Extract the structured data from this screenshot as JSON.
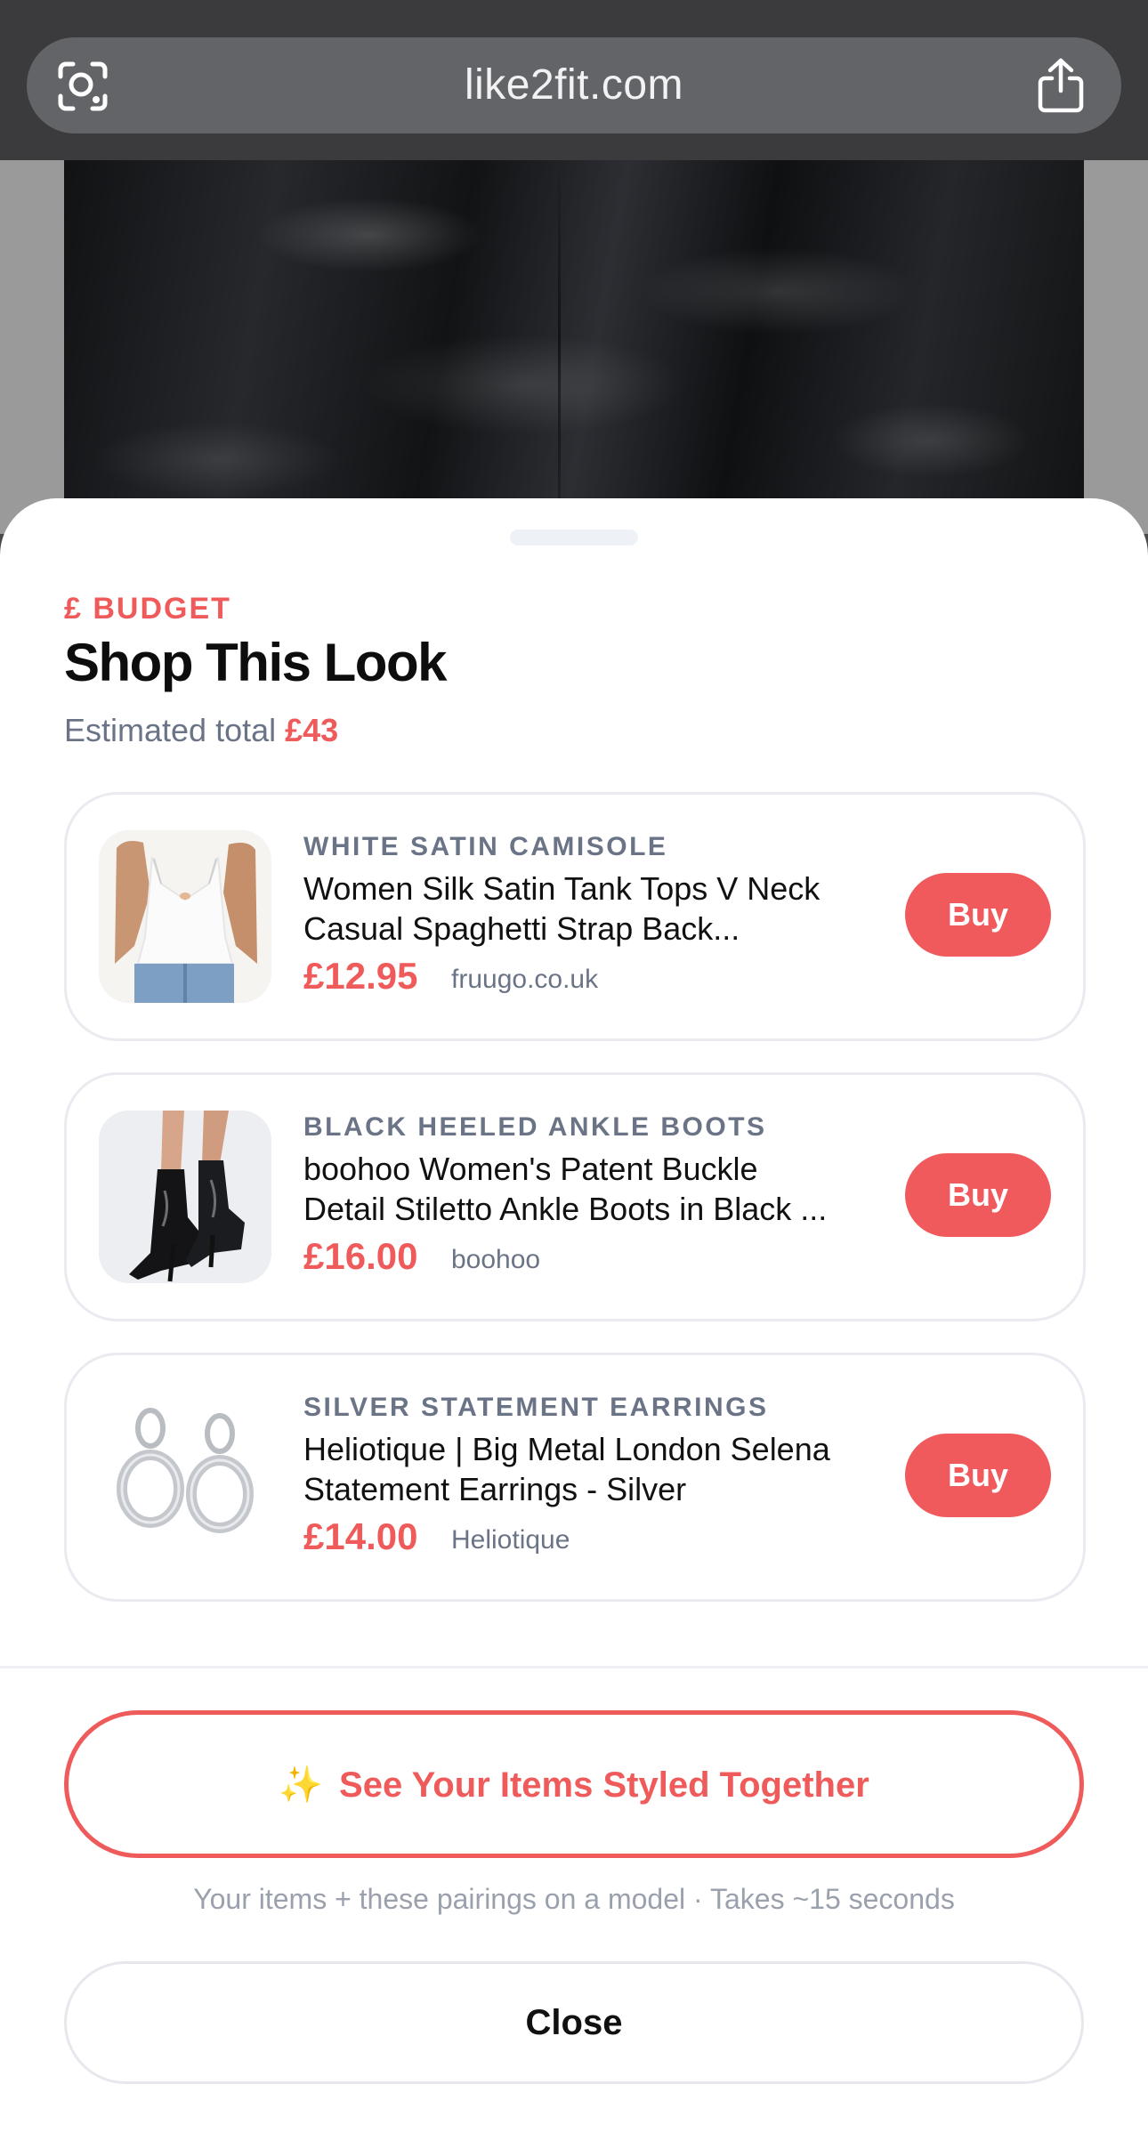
{
  "browser": {
    "url": "like2fit.com",
    "left_icon": "visual-search-icon",
    "right_icon": "share-icon"
  },
  "sheet": {
    "kicker": "£ BUDGET",
    "title": "Shop This Look",
    "estimate_label": "Estimated total",
    "estimate_value": "£43"
  },
  "products": [
    {
      "category": "WHITE SATIN CAMISOLE",
      "title": "Women Silk Satin Tank Tops V Neck\nCasual Spaghetti Strap Back...",
      "price": "£12.95",
      "retailer": "fruugo.co.uk",
      "buy_label": "Buy"
    },
    {
      "category": "BLACK HEELED ANKLE BOOTS",
      "title": "boohoo Women's Patent Buckle\nDetail Stiletto Ankle Boots in Black ...",
      "price": "£16.00",
      "retailer": "boohoo",
      "buy_label": "Buy"
    },
    {
      "category": "SILVER STATEMENT EARRINGS",
      "title": "Heliotique | Big Metal London Selena\nStatement Earrings - Silver",
      "price": "£14.00",
      "retailer": "Heliotique",
      "buy_label": "Buy"
    }
  ],
  "footer": {
    "cta_icon": "✨",
    "cta_label": "See Your Items Styled Together",
    "cta_subtitle": "Your items + these pairings on a model · Takes ~15 seconds",
    "close_label": "Close"
  },
  "colors": {
    "accent": "#ef5b5b",
    "buy_button": "#f15a5c",
    "muted_text": "#6b7487",
    "chrome": "#3b3b3d"
  }
}
